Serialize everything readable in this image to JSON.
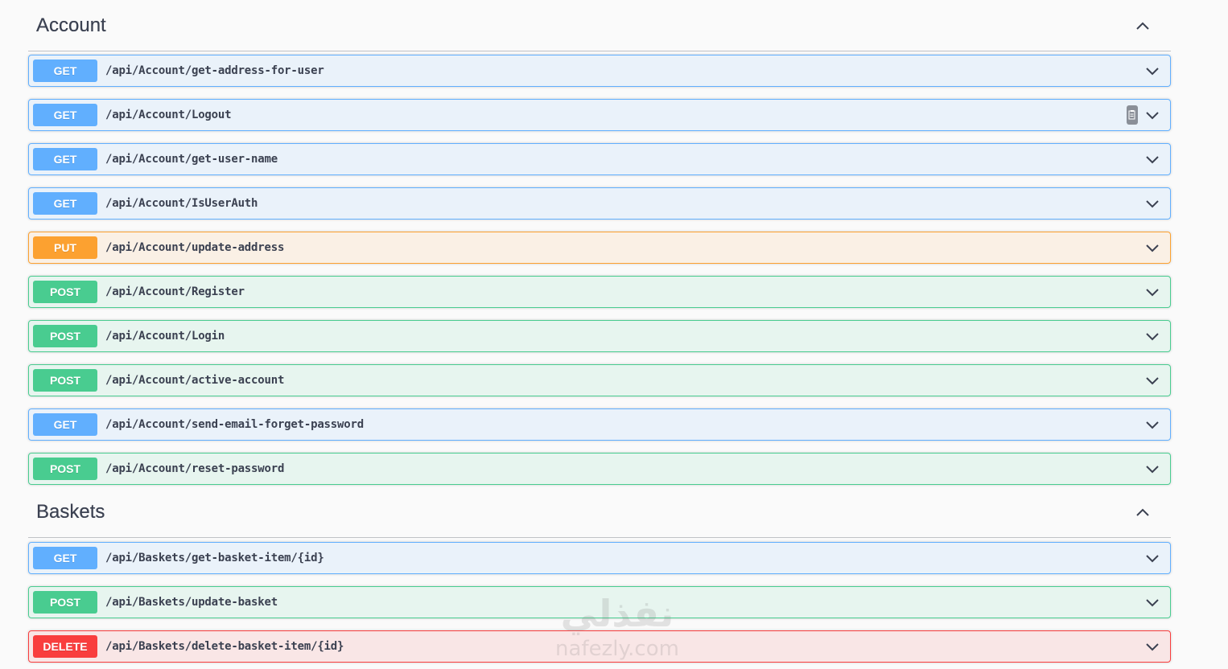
{
  "sections": [
    {
      "title": "Account",
      "operations": [
        {
          "method": "GET",
          "path": "/api/Account/get-address-for-user"
        },
        {
          "method": "GET",
          "path": "/api/Account/Logout"
        },
        {
          "method": "GET",
          "path": "/api/Account/get-user-name"
        },
        {
          "method": "GET",
          "path": "/api/Account/IsUserAuth"
        },
        {
          "method": "PUT",
          "path": "/api/Account/update-address"
        },
        {
          "method": "POST",
          "path": "/api/Account/Register"
        },
        {
          "method": "POST",
          "path": "/api/Account/Login"
        },
        {
          "method": "POST",
          "path": "/api/Account/active-account"
        },
        {
          "method": "GET",
          "path": "/api/Account/send-email-forget-password"
        },
        {
          "method": "POST",
          "path": "/api/Account/reset-password"
        }
      ]
    },
    {
      "title": "Baskets",
      "operations": [
        {
          "method": "GET",
          "path": "/api/Baskets/get-basket-item/{id}"
        },
        {
          "method": "POST",
          "path": "/api/Baskets/update-basket"
        },
        {
          "method": "DELETE",
          "path": "/api/Baskets/delete-basket-item/{id}"
        }
      ]
    }
  ],
  "watermark": {
    "arabic": "نفذلي",
    "latin": "nafezly.com"
  },
  "colors": {
    "get": "#61affe",
    "put": "#fca130",
    "post": "#49cc90",
    "delete": "#f93e3e",
    "text": "#3b4151"
  },
  "icons": {
    "collapse": "chevron-up-icon",
    "expand": "chevron-down-icon",
    "copy": "copy-icon"
  }
}
